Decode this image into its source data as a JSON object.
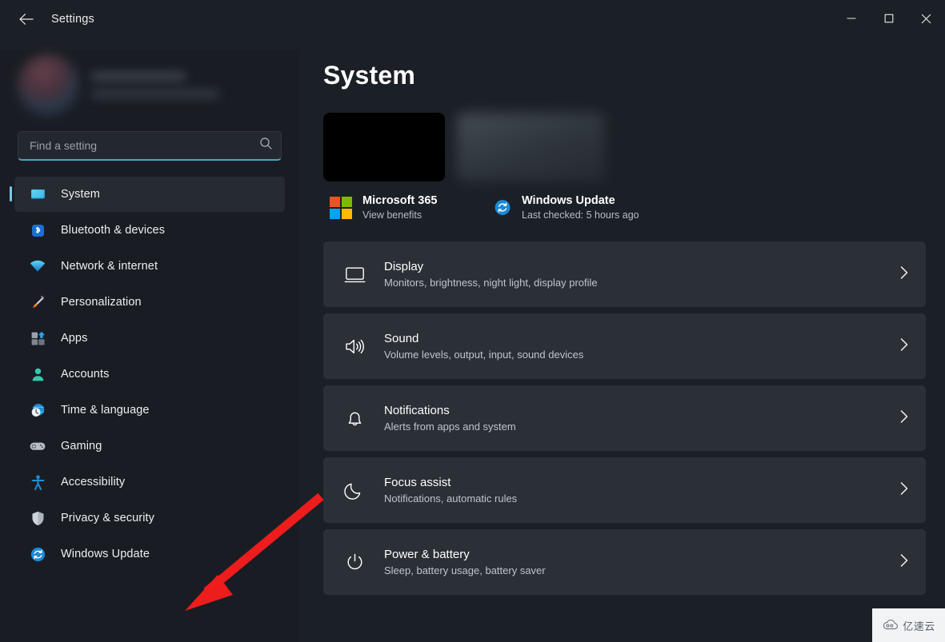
{
  "window": {
    "title": "Settings",
    "back_icon": "back-arrow-icon",
    "minimize_label": "─",
    "maximize_label": "□",
    "close_label": "✕"
  },
  "sidebar": {
    "profile": {
      "name_redacted": "",
      "email_redacted": ""
    },
    "search": {
      "placeholder": "Find a setting",
      "value": "",
      "icon": "search-icon"
    },
    "items": [
      {
        "label": "System",
        "icon": "monitor-icon",
        "selected": true
      },
      {
        "label": "Bluetooth & devices",
        "icon": "bluetooth-icon",
        "selected": false
      },
      {
        "label": "Network & internet",
        "icon": "wifi-icon",
        "selected": false
      },
      {
        "label": "Personalization",
        "icon": "paintbrush-icon",
        "selected": false
      },
      {
        "label": "Apps",
        "icon": "apps-icon",
        "selected": false
      },
      {
        "label": "Accounts",
        "icon": "person-icon",
        "selected": false
      },
      {
        "label": "Time & language",
        "icon": "clock-globe-icon",
        "selected": false
      },
      {
        "label": "Gaming",
        "icon": "gamepad-icon",
        "selected": false
      },
      {
        "label": "Accessibility",
        "icon": "accessibility-icon",
        "selected": false
      },
      {
        "label": "Privacy & security",
        "icon": "shield-icon",
        "selected": false
      },
      {
        "label": "Windows Update",
        "icon": "update-refresh-icon",
        "selected": false
      }
    ]
  },
  "main": {
    "page_title": "System",
    "status_cards": [
      {
        "title": "Microsoft 365",
        "subtitle": "View benefits",
        "icon": "microsoft-logo-icon"
      },
      {
        "title": "Windows Update",
        "subtitle": "Last checked: 5 hours ago",
        "icon": "update-refresh-icon"
      }
    ],
    "settings": [
      {
        "title": "Display",
        "subtitle": "Monitors, brightness, night light, display profile",
        "icon": "display-icon"
      },
      {
        "title": "Sound",
        "subtitle": "Volume levels, output, input, sound devices",
        "icon": "speaker-icon"
      },
      {
        "title": "Notifications",
        "subtitle": "Alerts from apps and system",
        "icon": "bell-icon"
      },
      {
        "title": "Focus assist",
        "subtitle": "Notifications, automatic rules",
        "icon": "moon-icon"
      },
      {
        "title": "Power & battery",
        "subtitle": "Sleep, battery usage, battery saver",
        "icon": "power-icon"
      }
    ]
  },
  "annotation": {
    "color": "#ee1c1c",
    "type": "arrow",
    "points_to": "Windows Update"
  },
  "watermark": {
    "text": "亿速云",
    "icon": "cloud-icon"
  },
  "colors": {
    "accent": "#4aa3c7",
    "selection_bar": "#79c7e8",
    "card": "#2b2f36",
    "sidebar_bg": "#191d23",
    "main_bg": "#1b2026",
    "annotation_red": "#ee1c1c"
  }
}
